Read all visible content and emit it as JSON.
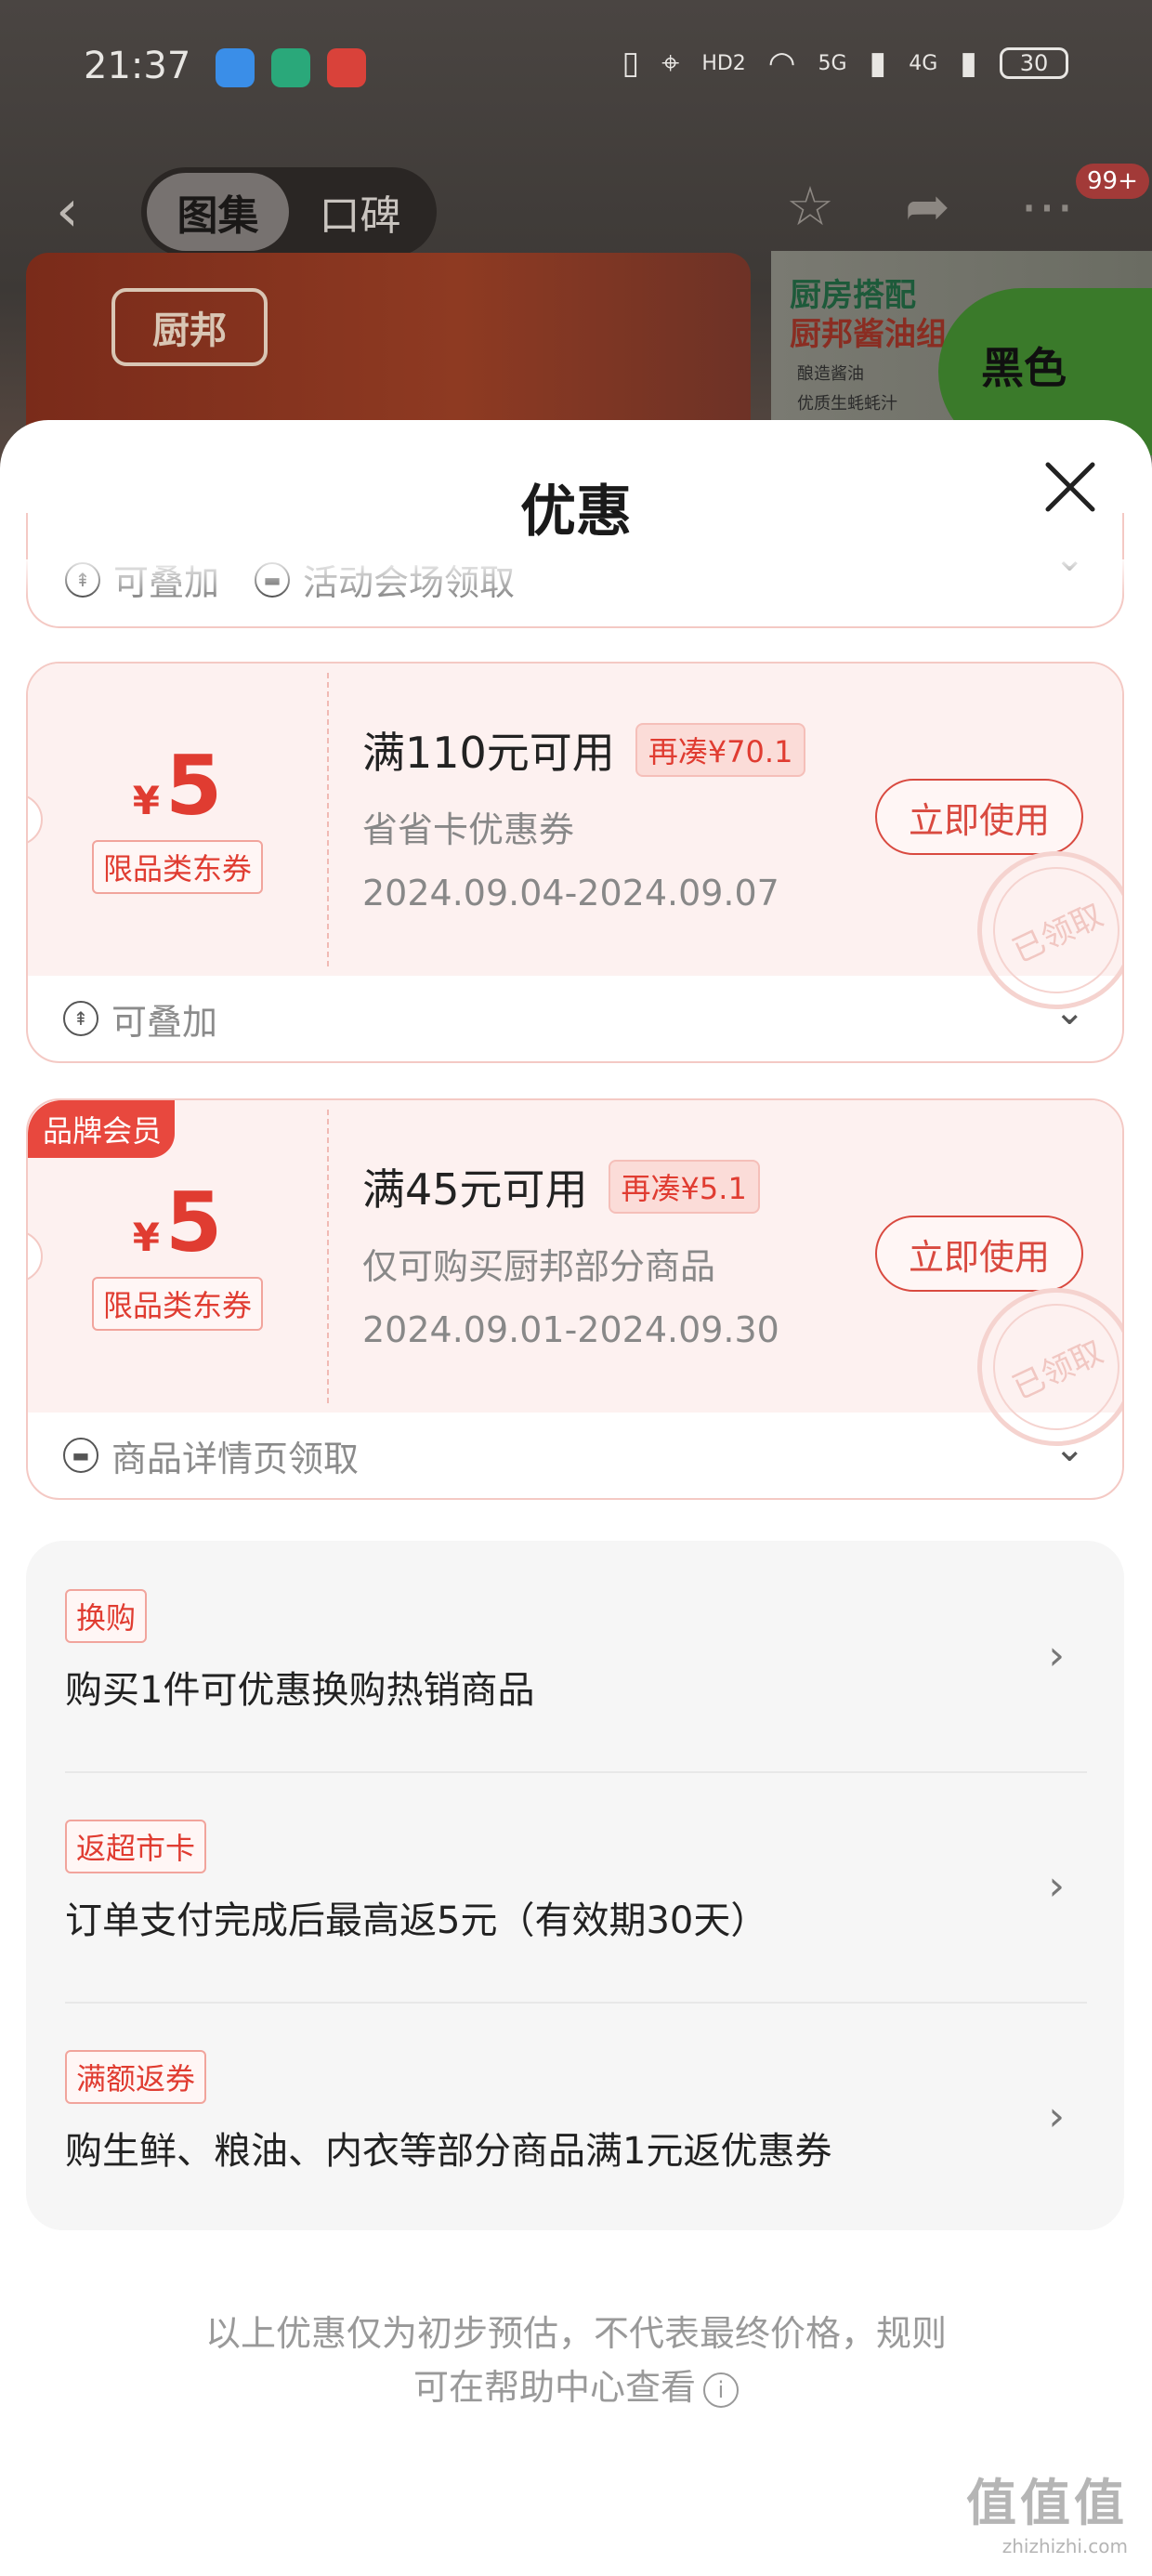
{
  "status_bar": {
    "time": "21:37",
    "network_labels": [
      "HD2",
      "5G",
      "4G"
    ],
    "battery": "30",
    "app_icons": [
      "weather-app-icon",
      "mi-home-app-icon",
      "zhi-app-icon"
    ],
    "app_icon_colors": [
      "#3a8ee8",
      "#2aa87a",
      "#d9423a"
    ]
  },
  "nav": {
    "tabs": [
      {
        "label": "图集",
        "active": true
      },
      {
        "label": "口碑",
        "active": false
      }
    ],
    "badge": "99+"
  },
  "banner": {
    "logo_text": "厨邦",
    "right_line1": "厨房搭配",
    "right_line2": "厨邦酱油组",
    "right_bullet1": "酿造酱油",
    "right_bullet2": "优质生蚝蚝汁",
    "promo_text": "黑色"
  },
  "sheet": {
    "title": "优惠",
    "partial_row": {
      "stack_label": "可叠加",
      "source_label": "活动会场领取"
    },
    "coupons": [
      {
        "currency": "¥",
        "amount": "5",
        "type_tag": "限品类东券",
        "condition": "满110元可用",
        "redeem_tag": "再凑¥70.1",
        "description": "省省卡优惠券",
        "dates": "2024.09.04-2024.09.07",
        "button": "立即使用",
        "stamp": "已领取",
        "footer": "可叠加",
        "member_badge": ""
      },
      {
        "currency": "¥",
        "amount": "5",
        "type_tag": "限品类东券",
        "condition": "满45元可用",
        "redeem_tag": "再凑¥5.1",
        "description": "仅可购买厨邦部分商品",
        "dates": "2024.09.01-2024.09.30",
        "button": "立即使用",
        "stamp": "已领取",
        "footer": "商品详情页领取",
        "member_badge": "品牌会员"
      }
    ],
    "promotions": [
      {
        "tag": "换购",
        "text": "购买1件可优惠换购热销商品"
      },
      {
        "tag": "返超市卡",
        "text": "订单支付完成后最高返5元（有效期30天）"
      },
      {
        "tag": "满额返券",
        "text": "购生鲜、粮油、内衣等部分商品满1元返优惠券"
      }
    ],
    "footnote_line1": "以上优惠仅为初步预估，不代表最终价格，规则",
    "footnote_line2": "可在帮助中心查看"
  },
  "watermark": {
    "brand": "值值值",
    "url": "zhizhizhi.com"
  },
  "colors": {
    "accent": "#e03c31",
    "coupon_bg": "#fdf1f0",
    "member_badge": "#e8483e"
  }
}
